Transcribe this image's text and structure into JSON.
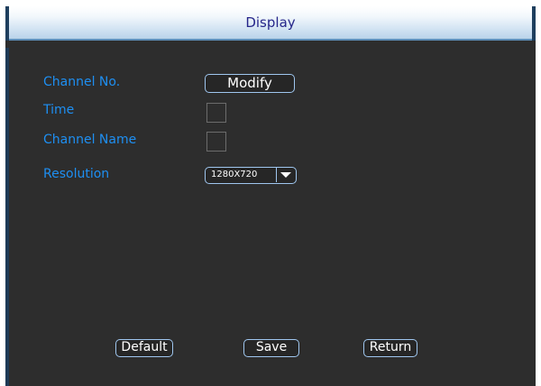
{
  "window": {
    "title": "Display"
  },
  "form": {
    "channel_no": {
      "label": "Channel No.",
      "button": "Modify"
    },
    "time": {
      "label": "Time",
      "checked": false
    },
    "channel_name": {
      "label": "Channel Name",
      "checked": false
    },
    "resolution": {
      "label": "Resolution",
      "value": "1280X720"
    }
  },
  "footer": {
    "default_label": "Default",
    "save_label": "Save",
    "return_label": "Return"
  },
  "icons": {
    "resolution_dropdown": "chevron-down-icon"
  },
  "colors": {
    "label": "#1e8ff2",
    "background": "#2d2d2d",
    "button_border": "#9fc6ef",
    "title_text": "#26268a"
  }
}
